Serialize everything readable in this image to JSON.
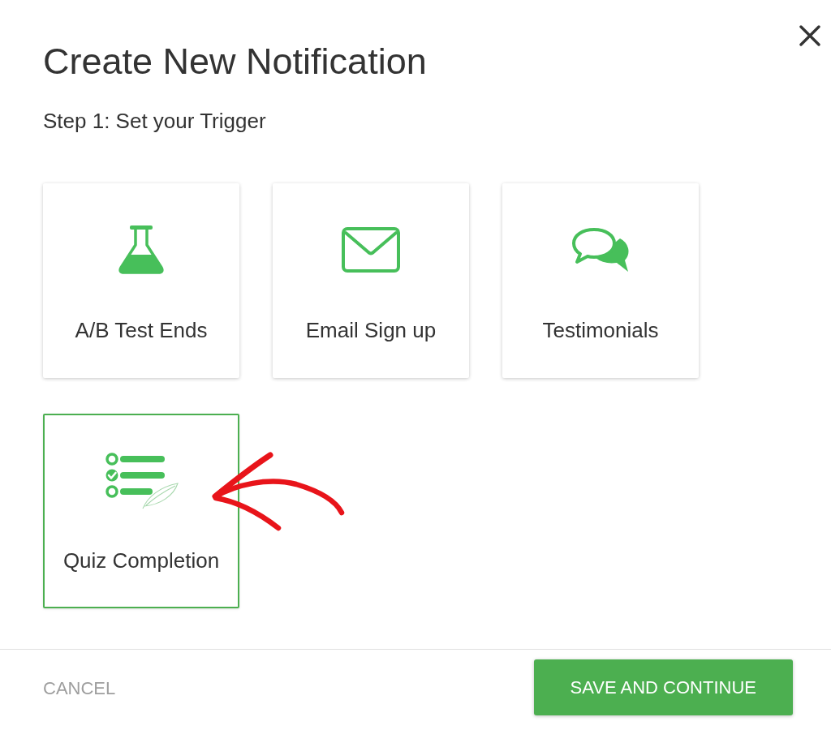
{
  "dialog": {
    "title": "Create New Notification",
    "step": "Step 1: Set your Trigger"
  },
  "triggers": [
    {
      "label": "A/B Test Ends",
      "selected": false
    },
    {
      "label": "Email Sign up",
      "selected": false
    },
    {
      "label": "Testimonials",
      "selected": false
    },
    {
      "label": "Quiz Completion",
      "selected": true
    }
  ],
  "footer": {
    "cancel": "CANCEL",
    "primary": "SAVE AND CONTINUE"
  }
}
